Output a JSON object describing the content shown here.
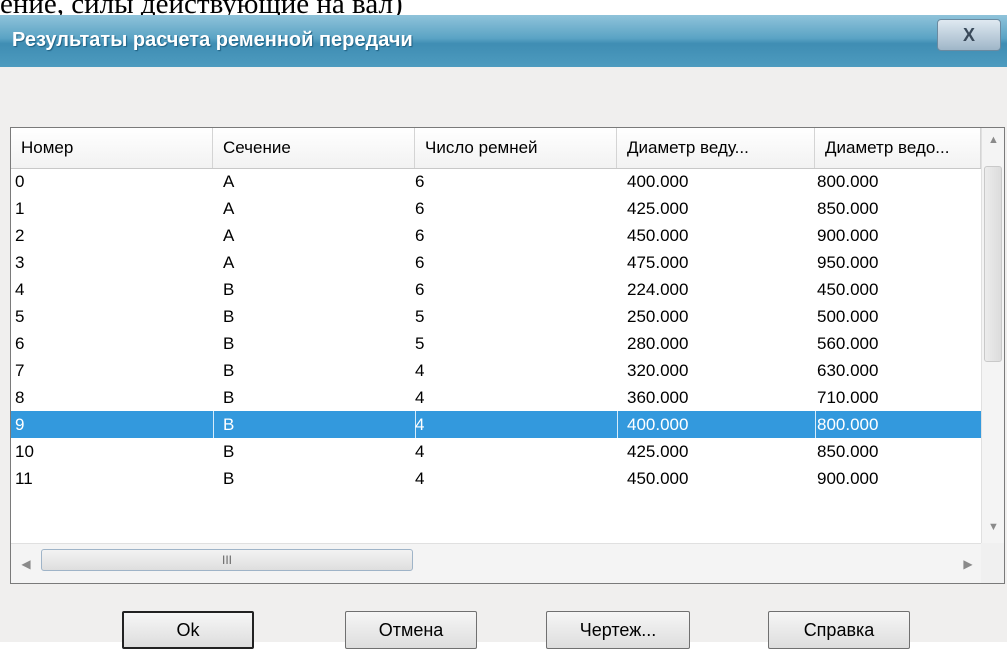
{
  "doc_fragment": "ение, силы действующие на вал)",
  "dialog": {
    "title": "Результаты расчета ременной передачи",
    "close_glyph": "X"
  },
  "table": {
    "columns": [
      "Номер",
      "Сечение",
      "Число ремней",
      "Диаметр веду...",
      "Диаметр ведо..."
    ],
    "rows": [
      [
        "0",
        "А",
        "6",
        "400.000",
        "800.000"
      ],
      [
        "1",
        "А",
        "6",
        "425.000",
        "850.000"
      ],
      [
        "2",
        "А",
        "6",
        "450.000",
        "900.000"
      ],
      [
        "3",
        "А",
        "6",
        "475.000",
        "950.000"
      ],
      [
        "4",
        "В",
        "6",
        "224.000",
        "450.000"
      ],
      [
        "5",
        "В",
        "5",
        "250.000",
        "500.000"
      ],
      [
        "6",
        "В",
        "5",
        "280.000",
        "560.000"
      ],
      [
        "7",
        "В",
        "4",
        "320.000",
        "630.000"
      ],
      [
        "8",
        "В",
        "4",
        "360.000",
        "710.000"
      ],
      [
        "9",
        "В",
        "4",
        "400.000",
        "800.000"
      ],
      [
        "10",
        "В",
        "4",
        "425.000",
        "850.000"
      ],
      [
        "11",
        "В",
        "4",
        "450.000",
        "900.000"
      ]
    ],
    "selected_row_index": 9,
    "selection_color": "#3399dd"
  },
  "scroll": {
    "up_icon": "▲",
    "down_icon": "▼",
    "left_icon": "◀",
    "right_icon": "▶",
    "grip_glyph": "III"
  },
  "buttons": {
    "ok": "Ok",
    "cancel": "Отмена",
    "drawing": "Чертеж...",
    "help": "Справка"
  }
}
